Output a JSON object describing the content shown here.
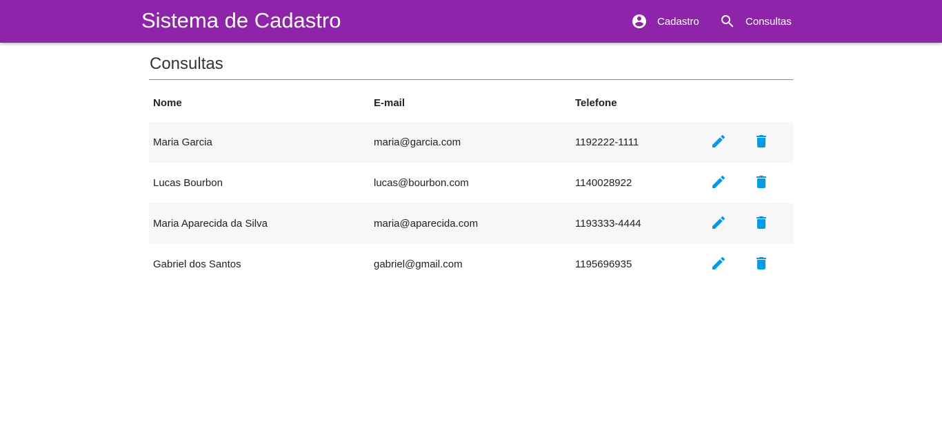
{
  "app": {
    "title": "Sistema de Cadastro"
  },
  "nav": {
    "items": [
      {
        "label": "Cadastro",
        "icon": "account-circle-icon"
      },
      {
        "label": "Consultas",
        "icon": "search-icon"
      }
    ]
  },
  "colors": {
    "navbar": "#8e24aa",
    "action_icon": "#039be5",
    "row_stripe": "#f7f7f7"
  },
  "page": {
    "title": "Consultas"
  },
  "table": {
    "headers": [
      "Nome",
      "E-mail",
      "Telefone"
    ],
    "rows": [
      {
        "nome": "Maria Garcia",
        "email": "maria@garcia.com",
        "telefone": "1192222-1111"
      },
      {
        "nome": "Lucas Bourbon",
        "email": "lucas@bourbon.com",
        "telefone": "1140028922"
      },
      {
        "nome": "Maria Aparecida da Silva",
        "email": "maria@aparecida.com",
        "telefone": "1193333-4444"
      },
      {
        "nome": "Gabriel dos Santos",
        "email": "gabriel@gmail.com",
        "telefone": "1195696935"
      }
    ]
  }
}
